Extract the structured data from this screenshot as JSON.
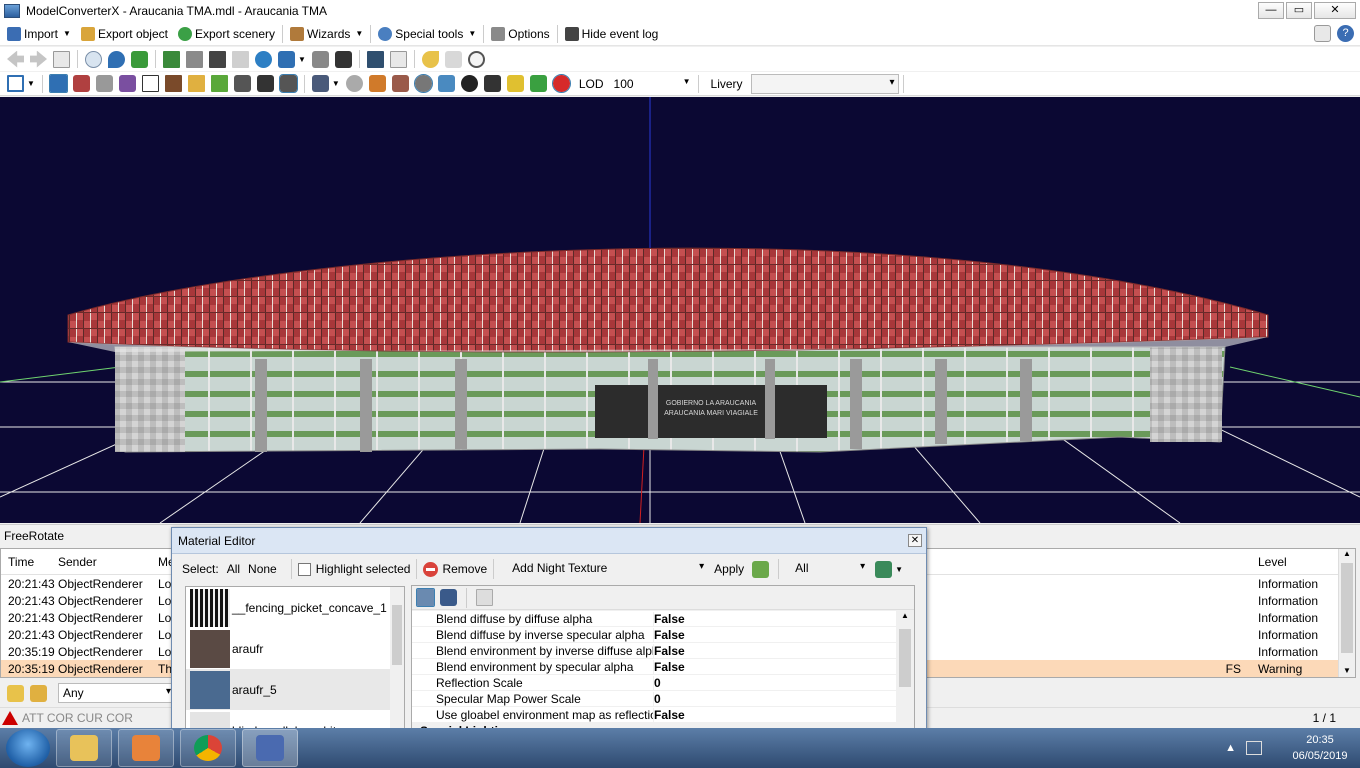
{
  "window": {
    "title": "ModelConverterX - Araucania TMA.mdl - Araucania TMA"
  },
  "menu": [
    {
      "label": "Import",
      "caret": true,
      "icon": "import-icon",
      "color": "#3b6db3"
    },
    {
      "label": "Export object",
      "caret": false,
      "icon": "export-object-icon",
      "color": "#d9a53b"
    },
    {
      "label": "Export scenery",
      "caret": false,
      "icon": "export-scenery-icon",
      "color": "#3ba046"
    },
    {
      "label": "Wizards",
      "caret": true,
      "icon": "wizard-icon",
      "color": "#b07a3b"
    },
    {
      "label": "Special tools",
      "caret": true,
      "icon": "gear-icon",
      "color": "#4a7fc0"
    },
    {
      "label": "Options",
      "caret": false,
      "icon": "tools-icon",
      "color": "#777777"
    },
    {
      "label": "Hide event log",
      "caret": false,
      "icon": "event-log-icon",
      "color": "#333333"
    }
  ],
  "toolbar2": {
    "lod_label": "LOD",
    "lod_value": "100",
    "livery_label": "Livery",
    "livery_value": ""
  },
  "viewport": {
    "background": "#0b0833",
    "building_texts": [
      "GOBIERNO LA ARAUCANIA",
      "ARAUCANIA MARI VIAGIALE"
    ]
  },
  "mode_label": "FreeRotate",
  "event_log": {
    "columns": {
      "time": "Time",
      "sender": "Sender",
      "message": "Me",
      "level": "Level"
    },
    "rows": [
      {
        "time": "20:21:43",
        "sender": "ObjectRenderer",
        "message": "Lo",
        "level": "Information",
        "warning": false
      },
      {
        "time": "20:21:43",
        "sender": "ObjectRenderer",
        "message": "Lo",
        "level": "Information",
        "warning": false
      },
      {
        "time": "20:21:43",
        "sender": "ObjectRenderer",
        "message": "Lo",
        "level": "Information",
        "warning": false
      },
      {
        "time": "20:21:43",
        "sender": "ObjectRenderer",
        "message": "Lo",
        "level": "Information",
        "warning": false
      },
      {
        "time": "20:35:19",
        "sender": "ObjectRenderer",
        "message": "Lo",
        "level": "Information",
        "warning": false
      },
      {
        "time": "20:35:19",
        "sender": "ObjectRenderer",
        "message": "Th",
        "message_tail": "FS",
        "level": "Warning",
        "warning": true
      }
    ]
  },
  "filter": {
    "value": "Any"
  },
  "status": {
    "left": "ATT COR  CUR COR",
    "page": "1 / 1"
  },
  "material_editor": {
    "title": "Material Editor",
    "select_label": "Select:",
    "all_label": "All",
    "none_label": "None",
    "highlight_label": "Highlight selected",
    "remove_label": "Remove",
    "night_texture_label": "Add Night Texture",
    "apply_label": "Apply",
    "filter_value": "All",
    "textures": [
      {
        "name": "__fencing_picket_concave_1",
        "color": "#2a2a2a"
      },
      {
        "name": "araufr",
        "color": "#5a4a44"
      },
      {
        "name": "araufr_5",
        "color": "#4a6a90"
      },
      {
        "name": "blinds_cellular_white",
        "color": "#e4e4e4"
      }
    ],
    "properties": [
      {
        "name": "Blend diffuse by diffuse alpha",
        "value": "False"
      },
      {
        "name": "Blend diffuse by inverse specular alpha",
        "value": "False"
      },
      {
        "name": "Blend environment by inverse diffuse alpha",
        "value": "False"
      },
      {
        "name": "Blend environment by specular alpha",
        "value": "False"
      },
      {
        "name": "Reflection Scale",
        "value": "0"
      },
      {
        "name": "Specular Map Power Scale",
        "value": "0"
      },
      {
        "name": "Use gloabel environment map as reflection",
        "value": "False"
      },
      {
        "name": "Special Lighting",
        "value": ""
      }
    ]
  },
  "taskbar": {
    "time": "20:35",
    "date": "06/05/2019"
  }
}
